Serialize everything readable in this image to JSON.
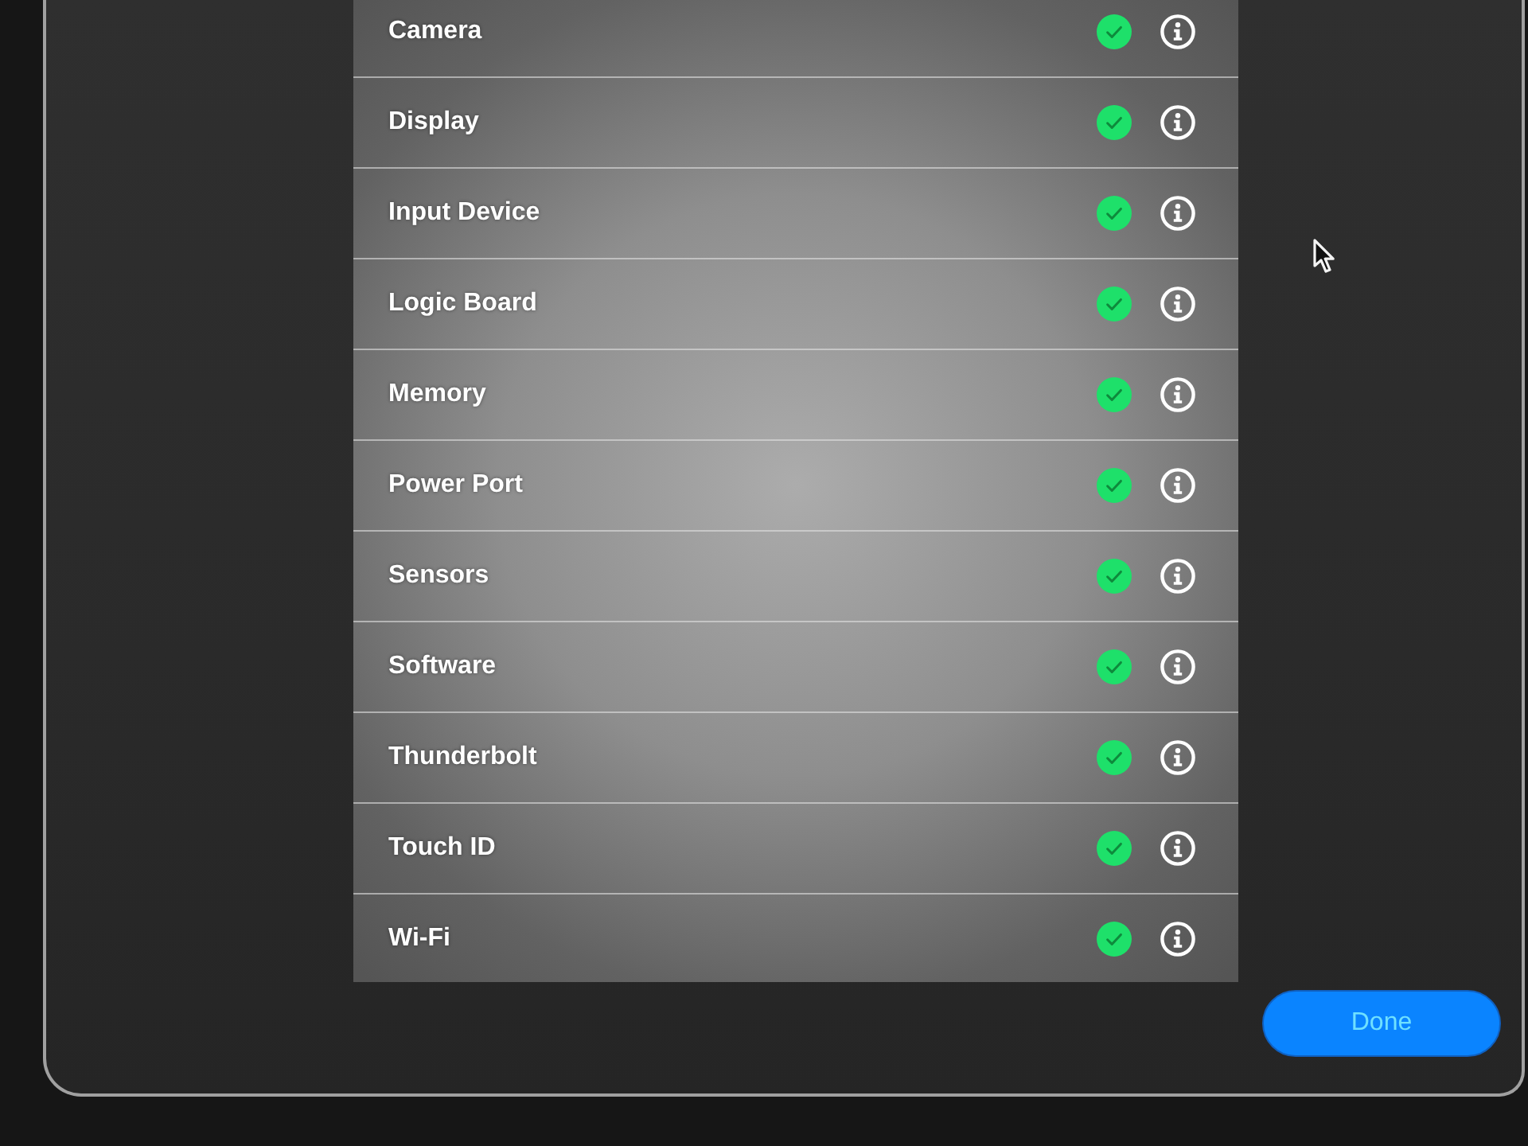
{
  "items": [
    {
      "label": "Camera",
      "passed": true
    },
    {
      "label": "Display",
      "passed": true
    },
    {
      "label": "Input Device",
      "passed": true
    },
    {
      "label": "Logic Board",
      "passed": true
    },
    {
      "label": "Memory",
      "passed": true
    },
    {
      "label": "Power Port",
      "passed": true
    },
    {
      "label": "Sensors",
      "passed": true
    },
    {
      "label": "Software",
      "passed": true
    },
    {
      "label": "Thunderbolt",
      "passed": true
    },
    {
      "label": "Touch ID",
      "passed": true
    },
    {
      "label": "Wi-Fi",
      "passed": true
    }
  ],
  "done_button": {
    "label": "Done"
  }
}
